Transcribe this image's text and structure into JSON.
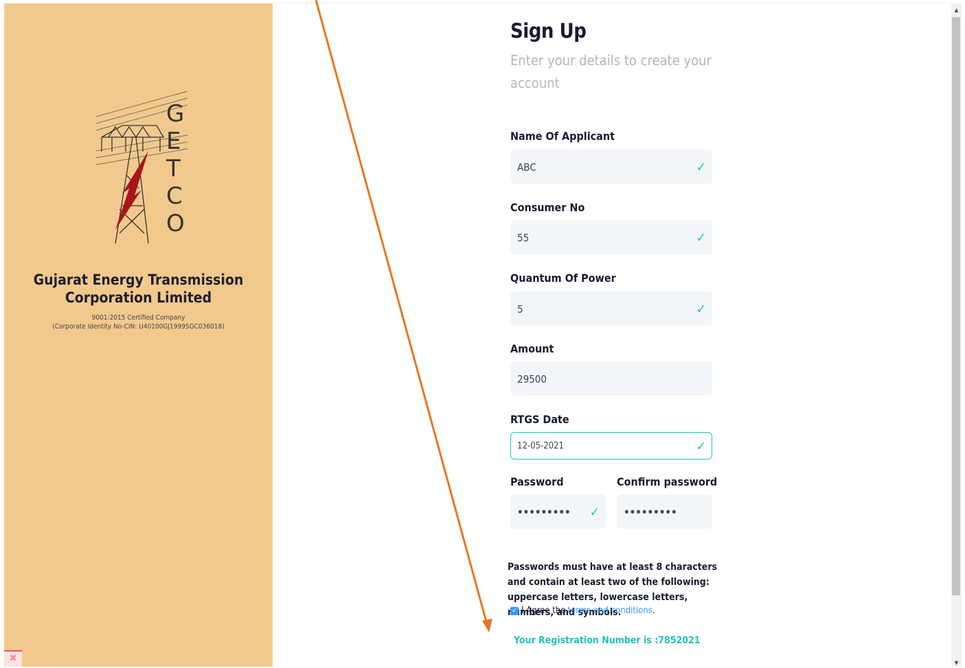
{
  "company": {
    "logo_letters": [
      "G",
      "E",
      "T",
      "C",
      "O"
    ],
    "name": "Gujarat Energy Transmission Corporation Limited",
    "certification": "9001:2015 Certified Company",
    "cin": "(Corporate Identity No-CIN: U40100GJ1999SGC036018)"
  },
  "form": {
    "title": "Sign Up",
    "subtitle": "Enter your details to create your account",
    "fields": {
      "name": {
        "label": "Name Of Applicant",
        "value": "ABC"
      },
      "consumer": {
        "label": "Consumer No",
        "value": "55"
      },
      "quantum": {
        "label": "Quantum Of Power",
        "value": "5"
      },
      "amount": {
        "label": "Amount",
        "value": "29500"
      },
      "rtgs": {
        "label": "RTGS Date",
        "value": "12-05-2021"
      },
      "password": {
        "label": "Password",
        "value": "•••••••••"
      },
      "confirm": {
        "label": "Confirm password",
        "value": "•••••••••"
      }
    },
    "password_hint": "Passwords must have at least 8 characters and contain at least two of the following: uppercase letters, lowercase letters, numbers, and symbols.",
    "agree_prefix": "I Agree the",
    "terms_link": "terms and conditions",
    "agree_suffix": ".",
    "registration": "Your Registration Number is :7852021"
  },
  "colors": {
    "panel": "#f2c98c",
    "success": "#1bc5bd",
    "link": "#3699ff",
    "annotation": "#e87722"
  }
}
